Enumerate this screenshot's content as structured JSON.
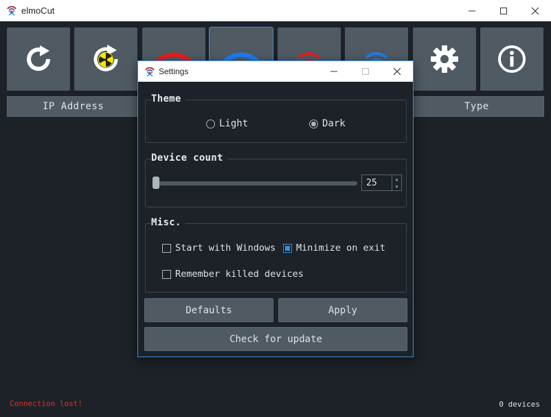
{
  "window": {
    "title": "elmoCut",
    "icons": {
      "app": "wifi-target-icon",
      "minimize": "minimize-icon",
      "maximize": "maximize-icon",
      "close": "close-icon"
    }
  },
  "toolbar": {
    "buttons": [
      {
        "name": "rescan",
        "icon": "refresh-icon",
        "color": "#ffffff"
      },
      {
        "name": "deep-scan",
        "icon": "radiation-refresh-icon",
        "color": "#f5e400"
      },
      {
        "name": "kill",
        "icon": "wifi-red-icon",
        "color": "#e02020"
      },
      {
        "name": "unkill",
        "icon": "wifi-blue-icon",
        "color": "#1e7bf0"
      },
      {
        "name": "kill-all",
        "icon": "wifi-small-red-icon",
        "color": "#e02020"
      },
      {
        "name": "unkill-all",
        "icon": "wifi-small-blue-icon",
        "color": "#1e7bf0"
      },
      {
        "name": "settings",
        "icon": "gear-icon",
        "color": "#ffffff"
      },
      {
        "name": "about",
        "icon": "info-icon",
        "color": "#ffffff"
      }
    ]
  },
  "table": {
    "columns": [
      "IP Address",
      "Type"
    ]
  },
  "status": {
    "left": "Connection lost!",
    "right": "0 devices",
    "left_color": "#e0302a"
  },
  "settings": {
    "title": "Settings",
    "theme": {
      "label": "Theme",
      "options": [
        "Light",
        "Dark"
      ],
      "selected": "Dark"
    },
    "device_count": {
      "label": "Device count",
      "value": "25"
    },
    "misc": {
      "label": "Misc.",
      "start_with_windows": {
        "label": "Start with Windows",
        "checked": false
      },
      "minimize_on_exit": {
        "label": "Minimize on exit",
        "checked": true
      },
      "remember_killed": {
        "label": "Remember killed devices",
        "checked": false
      }
    },
    "buttons": {
      "defaults": "Defaults",
      "apply": "Apply",
      "check_update": "Check for update"
    }
  },
  "colors": {
    "background": "#1d2228",
    "panel": "#4f5a63",
    "accent": "#3b8fd9"
  }
}
